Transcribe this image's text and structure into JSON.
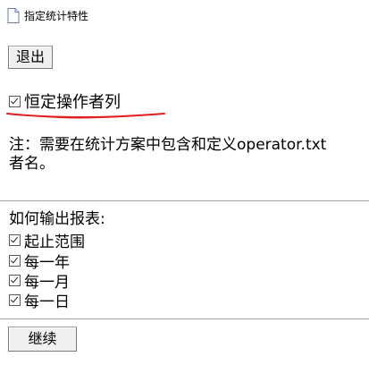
{
  "header": {
    "title": "指定统计特性",
    "icon": "document-icon"
  },
  "buttons": {
    "exit_label": "退出",
    "continue_label": "继续"
  },
  "constant_operator": {
    "label": "恒定操作者列",
    "checked": true,
    "annotation_color": "#e02020"
  },
  "note": {
    "text": "注：需要在统计方案中包含和定义operator.txt\n者名。"
  },
  "output": {
    "heading": "如何输出报表:",
    "options": [
      {
        "label": "起止范围",
        "checked": true
      },
      {
        "label": "每一年",
        "checked": true
      },
      {
        "label": "每一月",
        "checked": true
      },
      {
        "label": "每一日",
        "checked": true
      }
    ]
  }
}
